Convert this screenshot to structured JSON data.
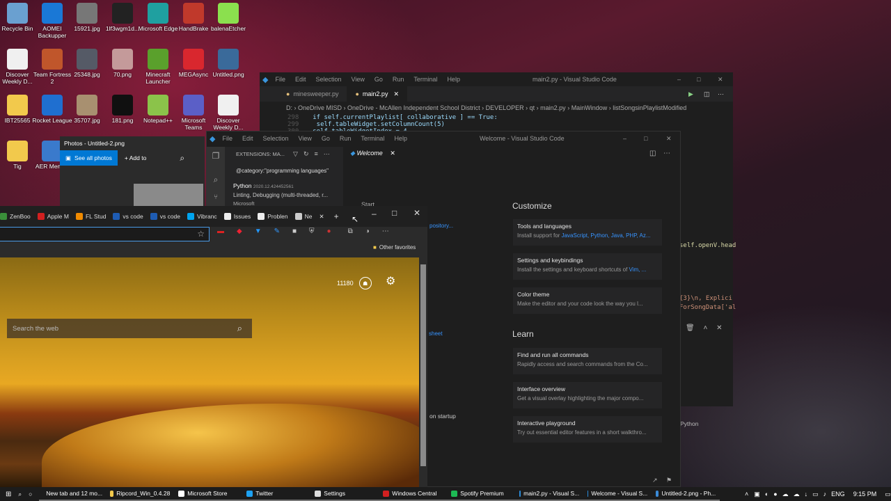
{
  "desktop_icons": [
    {
      "label": "Recycle Bin",
      "icon": "recycle-bin-icon",
      "color": "#6aa0d0"
    },
    {
      "label": "AOMEI Backupper",
      "icon": "aomei-icon",
      "color": "#1a78d6"
    },
    {
      "label": "15921.jpg",
      "icon": "image-icon",
      "color": "#777777"
    },
    {
      "label": "1lf3wgm1d...",
      "icon": "image-icon",
      "color": "#222222"
    },
    {
      "label": "Microsoft Edge",
      "icon": "edge-icon",
      "color": "#1fa0a0"
    },
    {
      "label": "HandBrake",
      "icon": "handbrake-icon",
      "color": "#c0392b"
    },
    {
      "label": "balenaEtcher",
      "icon": "etcher-icon",
      "color": "#8be04e"
    },
    {
      "label": "Discover Weekly D...",
      "icon": "json-file-icon",
      "color": "#f0f0f0"
    },
    {
      "label": "Team Fortress 2",
      "icon": "tf2-icon",
      "color": "#c0562b"
    },
    {
      "label": "25348.jpg",
      "icon": "image-icon",
      "color": "#555a66"
    },
    {
      "label": "70.png",
      "icon": "image-icon",
      "color": "#c49a9a"
    },
    {
      "label": "Minecraft Launcher",
      "icon": "minecraft-icon",
      "color": "#5aa02c"
    },
    {
      "label": "MEGAsync",
      "icon": "mega-icon",
      "color": "#d9272e"
    },
    {
      "label": "Untitled.png",
      "icon": "image-icon",
      "color": "#3a6a9a"
    },
    {
      "label": "IBT25565",
      "icon": "folder-icon",
      "color": "#f2c94c"
    },
    {
      "label": "Rocket League",
      "icon": "rocket-league-icon",
      "color": "#1f6fd0"
    },
    {
      "label": "35707.jpg",
      "icon": "image-icon",
      "color": "#a89070"
    },
    {
      "label": "181.png",
      "icon": "image-icon",
      "color": "#101010"
    },
    {
      "label": "Notepad++",
      "icon": "notepadpp-icon",
      "color": "#8bc34a"
    },
    {
      "label": "Microsoft Teams",
      "icon": "teams-icon",
      "color": "#5b5fc7"
    },
    {
      "label": "Discover Weekly D...",
      "icon": "json-file-icon",
      "color": "#f0f0f0"
    },
    {
      "label": "Tig",
      "icon": "folder-icon",
      "color": "#f2c94c"
    },
    {
      "label": "AER Memori",
      "icon": "aer-icon",
      "color": "#3a7acc"
    }
  ],
  "photos": {
    "title": "Photos - Untitled-2.png",
    "see_all": "See all photos",
    "add_to": "Add to"
  },
  "vscode_back": {
    "menu": [
      "File",
      "Edit",
      "Selection",
      "View",
      "Go",
      "Run",
      "Terminal",
      "Help"
    ],
    "title": "main2.py - Visual Studio Code",
    "tabs": [
      "minesweeper.py",
      "main2.py"
    ],
    "breadcrumb": [
      "D:",
      "OneDrive MISD",
      "OneDrive - McAllen Independent School District",
      "DEVELOPER",
      "qt",
      "main2.py",
      "MainWindow",
      "listSongsinPlaylistModified"
    ],
    "code_lines": [
      {
        "num": "298",
        "text": "if self.currentPlaylist[ collaborative ] == True:"
      },
      {
        "num": "299",
        "text": "    self.tableWidget.setColumnCount(5)"
      },
      {
        "num": "300",
        "text": "self.tableWidgetIndex = 4"
      }
    ],
    "right_code": [
      "self.openV.head",
      "{3}\\n, Explici",
      "ForSongData['al"
    ],
    "status_lang": "Python"
  },
  "vscode_front": {
    "menu": [
      "File",
      "Edit",
      "Selection",
      "View",
      "Go",
      "Run",
      "Terminal",
      "Help"
    ],
    "title": "Welcome - Visual Studio Code",
    "extensions_header": "EXTENSIONS: MA...",
    "search_query": "@category:\"programming languages\"",
    "extension": {
      "name": "Python",
      "version": "2020.12.424452561",
      "desc": "Linting, Debugging (multi-threaded, r...",
      "publisher": "Microsoft"
    },
    "tab": "Welcome",
    "start": "Start",
    "repository_link": "pository...",
    "sheet_link": "sheet",
    "startup_text": "on startup",
    "customize_heading": "Customize",
    "learn_heading": "Learn",
    "customize_cards": [
      {
        "title": "Tools and languages",
        "desc": "Install support for ",
        "links": "JavaScript, Python, Java, PHP, Az..."
      },
      {
        "title": "Settings and keybindings",
        "desc": "Install the settings and keyboard shortcuts of ",
        "links": "Vim, ..."
      },
      {
        "title": "Color theme",
        "desc": "Make the editor and your code look the way you l...",
        "links": ""
      }
    ],
    "learn_cards": [
      {
        "title": "Find and run all commands",
        "desc": "Rapidly access and search commands from the Co..."
      },
      {
        "title": "Interface overview",
        "desc": "Get a visual overlay highlighting the major compo..."
      },
      {
        "title": "Interactive playground",
        "desc": "Try out essential editor features in a short walkthro..."
      }
    ]
  },
  "edge": {
    "tabs": [
      {
        "label": "ZenBoo",
        "color": "#3a8f3a"
      },
      {
        "label": "Apple M",
        "color": "#d22020"
      },
      {
        "label": "FL Stud",
        "color": "#f08a00"
      },
      {
        "label": "vs code",
        "color": "#1e5cb3"
      },
      {
        "label": "vs code",
        "color": "#1e5cb3"
      },
      {
        "label": "Vibranc",
        "color": "#00a4ef"
      },
      {
        "label": "Issues",
        "color": "#eeeeee"
      },
      {
        "label": "Problen",
        "color": "#eeeeee"
      },
      {
        "label": "Ne",
        "color": "#cccccc"
      }
    ],
    "favorites": "Other favorites",
    "search_placeholder": "Search the web",
    "points": "11180"
  },
  "taskbar": {
    "items": [
      {
        "label": "New tab and 12 mo...",
        "color": "#1fa0a0"
      },
      {
        "label": "Ripcord_Win_0.4.28",
        "color": "#f2c94c"
      },
      {
        "label": "Microsoft Store",
        "color": "#ffffff"
      },
      {
        "label": "Twitter",
        "color": "#1da1f2"
      },
      {
        "label": "Settings",
        "color": "#dddddd"
      },
      {
        "label": "Windows Central",
        "color": "#d22020"
      },
      {
        "label": "Spotify Premium",
        "color": "#1db954"
      },
      {
        "label": "main2.py - Visual S...",
        "color": "#2a8ad8"
      },
      {
        "label": "Welcome - Visual S...",
        "color": "#2a8ad8"
      },
      {
        "label": "Untitled-2.png - Ph...",
        "color": "#3a8ad8"
      }
    ],
    "lang": "ENG",
    "time": "9:15 PM"
  }
}
